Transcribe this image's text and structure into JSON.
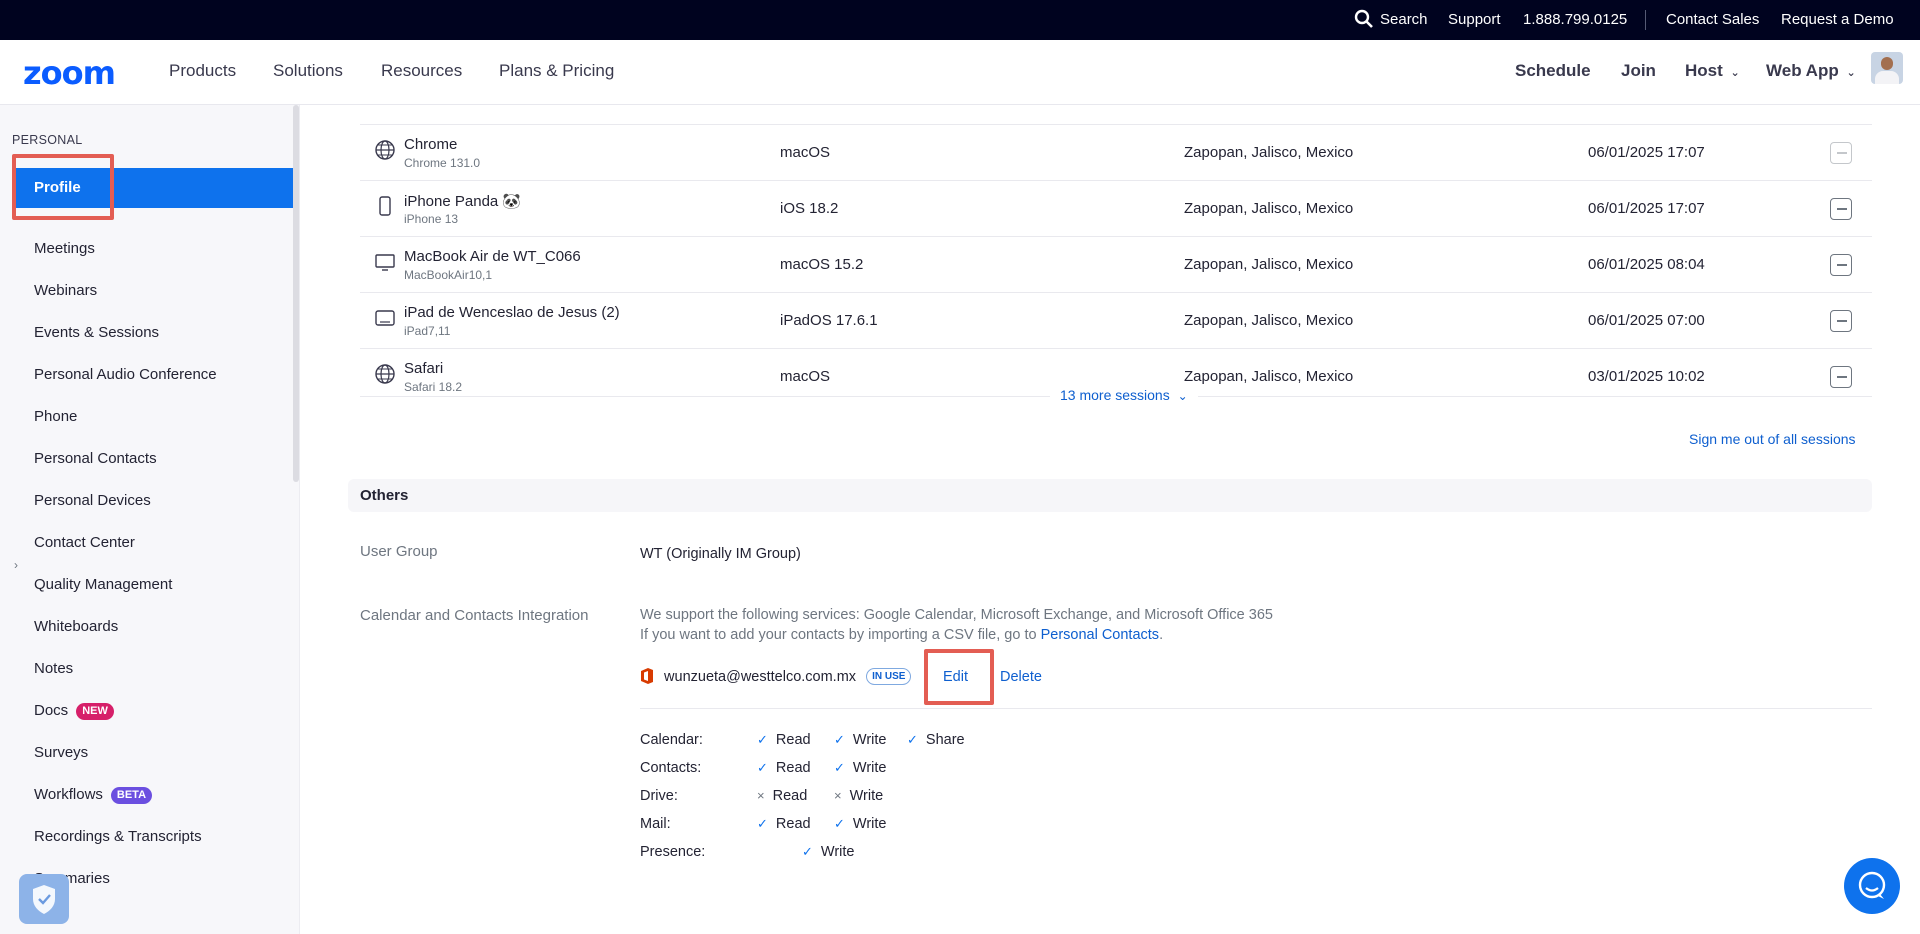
{
  "topbar": {
    "search": "Search",
    "support": "Support",
    "phone": "1.888.799.0125",
    "contact_sales": "Contact Sales",
    "request_demo": "Request a Demo"
  },
  "nav": {
    "logo": "zoom",
    "products": "Products",
    "solutions": "Solutions",
    "resources": "Resources",
    "plans": "Plans & Pricing",
    "schedule": "Schedule",
    "join": "Join",
    "host": "Host",
    "webapp": "Web App"
  },
  "sidebar": {
    "section": "PERSONAL",
    "items": [
      {
        "label": "Profile"
      },
      {
        "label": "Meetings"
      },
      {
        "label": "Webinars"
      },
      {
        "label": "Events & Sessions"
      },
      {
        "label": "Personal Audio Conference"
      },
      {
        "label": "Phone"
      },
      {
        "label": "Personal Contacts"
      },
      {
        "label": "Personal Devices"
      },
      {
        "label": "Contact Center"
      },
      {
        "label": "Quality Management"
      },
      {
        "label": "Whiteboards"
      },
      {
        "label": "Notes"
      },
      {
        "label": "Docs",
        "badge": "NEW"
      },
      {
        "label": "Surveys"
      },
      {
        "label": "Workflows",
        "badge": "BETA"
      },
      {
        "label": "Recordings & Transcripts"
      },
      {
        "label": "Summaries"
      }
    ]
  },
  "sessions": [
    {
      "name": "Chrome",
      "sub": "Chrome 131.0",
      "os": "macOS",
      "location": "Zapopan, Jalisco, Mexico",
      "time": "06/01/2025 17:07",
      "icon": "globe-icon"
    },
    {
      "name": "iPhone Panda 🐼",
      "sub": "iPhone 13",
      "os": "iOS 18.2",
      "location": "Zapopan, Jalisco, Mexico",
      "time": "06/01/2025 17:07",
      "icon": "phone-icon"
    },
    {
      "name": "MacBook Air de WT_C066",
      "sub": "MacBookAir10,1",
      "os": "macOS 15.2",
      "location": "Zapopan, Jalisco, Mexico",
      "time": "06/01/2025 08:04",
      "icon": "monitor-icon"
    },
    {
      "name": "iPad de Wenceslao de Jesus (2)",
      "sub": "iPad7,11",
      "os": "iPadOS 17.6.1",
      "location": "Zapopan, Jalisco, Mexico",
      "time": "06/01/2025 07:00",
      "icon": "tablet-icon"
    },
    {
      "name": "Safari",
      "sub": "Safari 18.2",
      "os": "macOS",
      "location": "Zapopan, Jalisco, Mexico",
      "time": "03/01/2025 10:02",
      "icon": "globe-icon"
    }
  ],
  "more_sessions": "13 more sessions",
  "sign_out_all": "Sign me out of all sessions",
  "others": {
    "title": "Others",
    "user_group_label": "User Group",
    "user_group_value": "WT (Originally IM Group)",
    "calendar_label": "Calendar and Contacts Integration",
    "support_text": "We support the following services: Google Calendar, Microsoft Exchange, and Microsoft Office 365",
    "csv_text": "If you want to add your contacts by importing a CSV file, go to",
    "csv_link": "Personal Contacts",
    "csv_period": ".",
    "email": "wunzueta@westtelco.com.mx",
    "in_use": "IN USE",
    "edit": "Edit",
    "delete": "Delete",
    "permissions": [
      {
        "label": "Calendar:",
        "items": [
          {
            "mark": "✓",
            "text": "Read"
          },
          {
            "mark": "✓",
            "text": "Write"
          },
          {
            "mark": "✓",
            "text": "Share"
          }
        ]
      },
      {
        "label": "Contacts:",
        "items": [
          {
            "mark": "✓",
            "text": "Read"
          },
          {
            "mark": "✓",
            "text": "Write"
          }
        ]
      },
      {
        "label": "Drive:",
        "items": [
          {
            "mark": "×",
            "text": "Read"
          },
          {
            "mark": "×",
            "text": "Write"
          }
        ]
      },
      {
        "label": "Mail:",
        "items": [
          {
            "mark": "✓",
            "text": "Read"
          },
          {
            "mark": "✓",
            "text": "Write"
          }
        ]
      },
      {
        "label": "Presence:",
        "items": [
          {
            "mark": "✓",
            "text": "Write"
          }
        ]
      }
    ]
  },
  "colors": {
    "accent": "#0e72ed",
    "highlight": "#e35d53",
    "topbar": "#00031f",
    "badge_new": "#d61f69",
    "badge_beta": "#6b4fe0"
  }
}
